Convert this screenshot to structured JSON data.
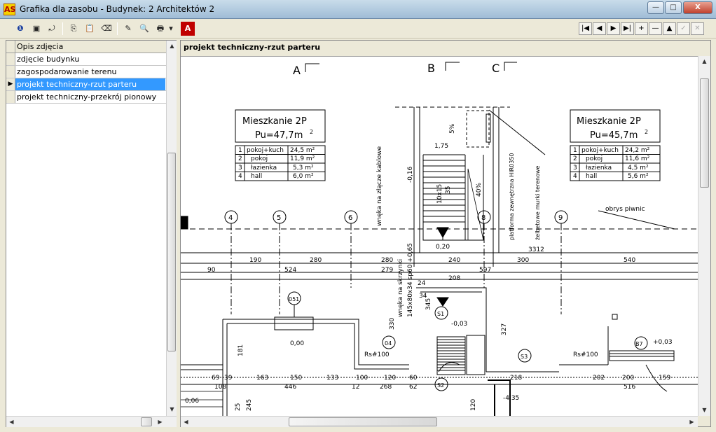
{
  "window": {
    "title": "Grafika dla zasobu - Budynek: 2 Architektów 2",
    "app_icon": "AS",
    "minimize_label": "—",
    "maximize_label": "□",
    "close_label": "X"
  },
  "toolbar": {
    "b1": "❶",
    "b2": "▣",
    "b3": "⤾",
    "b4": "⎘",
    "b5": "📋",
    "b6": "⌫",
    "b7": "✎",
    "b8": "🔍",
    "b9": "🖶",
    "b10": "▾",
    "b11": "A"
  },
  "nav": {
    "first": "|◀",
    "prev": "◀",
    "next": "▶",
    "last": "▶|",
    "add": "+",
    "remove": "—",
    "up": "▲",
    "save": "✓",
    "cancel": "✕"
  },
  "list": {
    "header": "Opis zdjęcia",
    "items": [
      {
        "label": "zdjęcie budynku"
      },
      {
        "label": "zagospodarowanie terenu"
      },
      {
        "label": "projekt techniczny-rzut parteru"
      },
      {
        "label": "projekt techniczny-przekrój pionowy"
      }
    ],
    "selected_indicator": "▶"
  },
  "image": {
    "title": "projekt techniczny-rzut parteru"
  },
  "drawing": {
    "axes": [
      "A",
      "B",
      "C"
    ],
    "grid": [
      "4",
      "5",
      "6",
      "8",
      "9"
    ],
    "apt1": {
      "title": "Mieszkanie  2P",
      "area": "Pu=47,7m",
      "sup": "2",
      "rows": [
        [
          "1",
          "pokoj+kuch",
          "24,5 m²"
        ],
        [
          "2",
          "pokoj",
          "11,9 m²"
        ],
        [
          "3",
          "łazienka",
          "5,3 m²"
        ],
        [
          "4",
          "hall",
          "6,0 m²"
        ]
      ]
    },
    "apt2": {
      "title": "Mieszkanie  2P",
      "area": "Pu=45,7m",
      "sup": "2",
      "rows": [
        [
          "1",
          "pokoj+kuch",
          "24,2 m²"
        ],
        [
          "2",
          "pokoj",
          "11,6 m²"
        ],
        [
          "3",
          "łazienka",
          "4,5 m²"
        ],
        [
          "4",
          "hall",
          "5,6 m²"
        ]
      ]
    },
    "dims1": [
      "190",
      "280",
      "280",
      "240",
      "300",
      "540"
    ],
    "dims2": [
      "90",
      "524",
      "279",
      "597"
    ],
    "labels": {
      "basement": "obrys piwnic",
      "cable": "wnęka na złącze kablowe",
      "box": "wnęka na skrzynki",
      "box_dim": "145x80x34 sp60 +0,65",
      "platform": "platforma zewnętrzna HIR0350",
      "wall": "żelbetowe murki terenowe",
      "stairs": "10x15",
      "stairs2": "35",
      "pct1": "5%",
      "pct2": "40%",
      "l175": "1,75",
      "l016": "-0,16",
      "l020": "0,20",
      "l3312": "3312",
      "l208": "208",
      "l24": "24",
      "l34": "34",
      "l345": "345",
      "l330": "330",
      "l327": "327",
      "l000": "0,00",
      "l003": "-0,03",
      "l003b": "+0,03",
      "l435": "-4,35",
      "l006": "0,06",
      "s1": "S1",
      "s2": "S2",
      "s3": "S3",
      "d051": "051",
      "d04": "04",
      "d87": "B7",
      "rs1": "Rs#100",
      "rs2": "Rs#100",
      "b69": "69",
      "b39": "39",
      "b163": "163",
      "b150": "150",
      "b133": "133",
      "b100": "100",
      "b120": "120",
      "b60": "60",
      "b108": "108",
      "b446": "446",
      "b12": "12",
      "b268": "268",
      "b62": "62",
      "b218": "218",
      "b202": "202",
      "b200": "200",
      "b516": "516",
      "b159": "159",
      "b181": "181",
      "b120v": "120",
      "b25": "25",
      "b245": "245"
    }
  }
}
